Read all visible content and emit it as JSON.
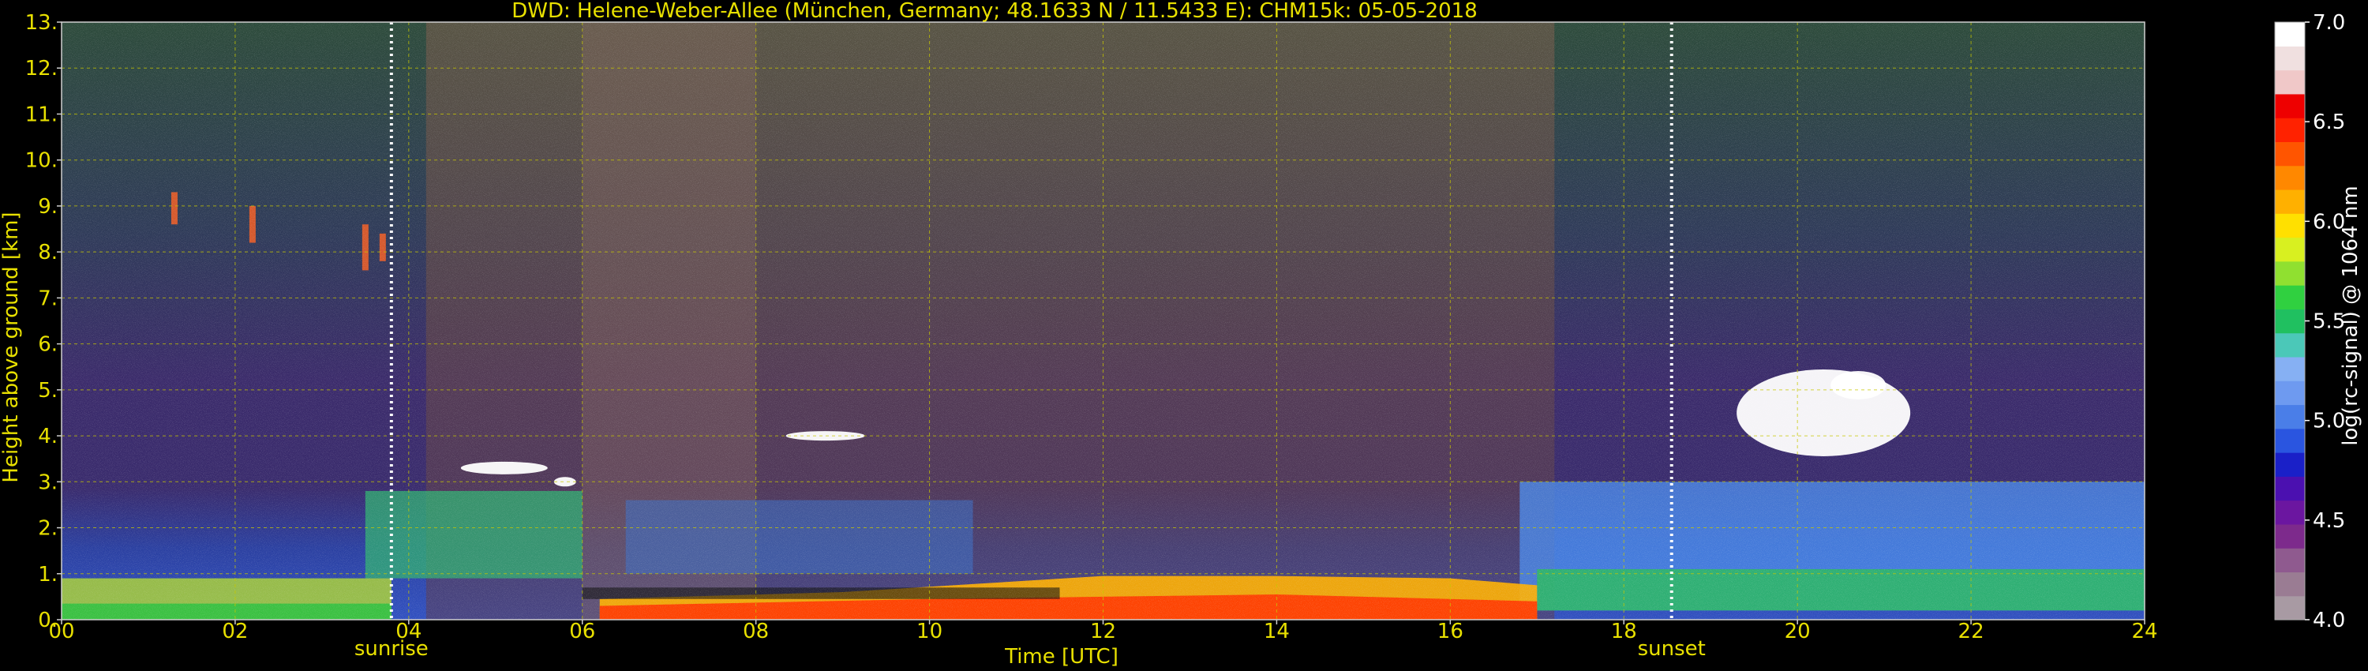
{
  "chart_data": {
    "type": "heatmap",
    "title": "DWD: Helene-Weber-Allee (München, Germany; 48.1633 N / 11.5433 E):    CHM15k: 05-05-2018",
    "xlabel": "Time [UTC]",
    "ylabel": "Height above ground [km]",
    "xlim": [
      0,
      24
    ],
    "ylim": [
      0,
      13
    ],
    "x_ticks": [
      0,
      2,
      4,
      6,
      8,
      10,
      12,
      14,
      16,
      18,
      20,
      22,
      24
    ],
    "x_tick_labels": [
      "00",
      "02",
      "04",
      "06",
      "08",
      "10",
      "12",
      "14",
      "16",
      "18",
      "20",
      "22",
      "24"
    ],
    "y_ticks": [
      0,
      1,
      2,
      3,
      4,
      5,
      6,
      7,
      8,
      9,
      10,
      11,
      12,
      13
    ],
    "y_tick_labels": [
      "0.",
      "1.",
      "2.",
      "3.",
      "4.",
      "5.",
      "6.",
      "7.",
      "8.",
      "9.",
      "10.",
      "11.",
      "12.",
      "13."
    ],
    "grid": true,
    "markers": [
      {
        "time": 3.8,
        "label": "sunrise"
      },
      {
        "time": 18.55,
        "label": "sunset"
      }
    ],
    "colorbar": {
      "label": "log(rc-signal) @ 1064 nm",
      "vmin": 4.0,
      "vmax": 7.0,
      "ticks": [
        4.0,
        4.5,
        5.0,
        5.5,
        6.0,
        6.5,
        7.0
      ],
      "tick_labels": [
        "4.0",
        "4.5",
        "5.0",
        "5.5",
        "6.0",
        "6.5",
        "7.0"
      ],
      "colors": [
        "#a89aa3",
        "#9a7c93",
        "#8f5a8f",
        "#7d2a8c",
        "#6b16a0",
        "#4b10b0",
        "#1a20c8",
        "#2a55e0",
        "#4a7ee8",
        "#6e9af0",
        "#86b0f3",
        "#4bc8b8",
        "#20c060",
        "#30d040",
        "#90e030",
        "#d8f020",
        "#ffe000",
        "#ffb000",
        "#ff8800",
        "#ff5500",
        "#ff2200",
        "#ee0000",
        "#f0c8c8",
        "#f0e0e0",
        "#ffffff"
      ]
    },
    "colors": {
      "axis_text": "#e8e000",
      "grid": "#c8c800",
      "background": "#000000"
    }
  }
}
